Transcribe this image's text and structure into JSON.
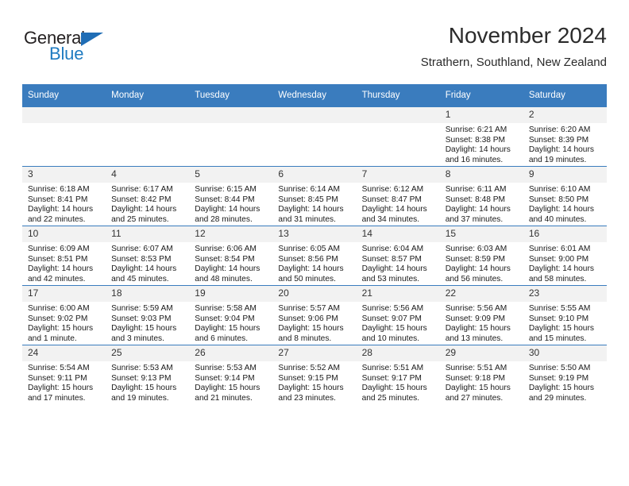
{
  "brand": {
    "name_line1": "General",
    "name_line2": "Blue",
    "triangle_icon": "triangle-icon",
    "colors": {
      "text": "#231f20",
      "blue": "#1f7bc1"
    }
  },
  "header": {
    "title": "November 2024",
    "subtitle": "Strathern, Southland, New Zealand"
  },
  "theme": {
    "header_blue": "#3a7cbe",
    "daynum_band": "#f2f2f2",
    "page_bg": "#ffffff"
  },
  "calendar": {
    "weekday_headers": [
      "Sunday",
      "Monday",
      "Tuesday",
      "Wednesday",
      "Thursday",
      "Friday",
      "Saturday"
    ],
    "weeks": [
      [
        {
          "day": "",
          "empty": true
        },
        {
          "day": "",
          "empty": true
        },
        {
          "day": "",
          "empty": true
        },
        {
          "day": "",
          "empty": true
        },
        {
          "day": "",
          "empty": true
        },
        {
          "day": "1",
          "sunrise": "Sunrise: 6:21 AM",
          "sunset": "Sunset: 8:38 PM",
          "daylight_line1": "Daylight: 14 hours",
          "daylight_line2": "and 16 minutes."
        },
        {
          "day": "2",
          "sunrise": "Sunrise: 6:20 AM",
          "sunset": "Sunset: 8:39 PM",
          "daylight_line1": "Daylight: 14 hours",
          "daylight_line2": "and 19 minutes."
        }
      ],
      [
        {
          "day": "3",
          "sunrise": "Sunrise: 6:18 AM",
          "sunset": "Sunset: 8:41 PM",
          "daylight_line1": "Daylight: 14 hours",
          "daylight_line2": "and 22 minutes."
        },
        {
          "day": "4",
          "sunrise": "Sunrise: 6:17 AM",
          "sunset": "Sunset: 8:42 PM",
          "daylight_line1": "Daylight: 14 hours",
          "daylight_line2": "and 25 minutes."
        },
        {
          "day": "5",
          "sunrise": "Sunrise: 6:15 AM",
          "sunset": "Sunset: 8:44 PM",
          "daylight_line1": "Daylight: 14 hours",
          "daylight_line2": "and 28 minutes."
        },
        {
          "day": "6",
          "sunrise": "Sunrise: 6:14 AM",
          "sunset": "Sunset: 8:45 PM",
          "daylight_line1": "Daylight: 14 hours",
          "daylight_line2": "and 31 minutes."
        },
        {
          "day": "7",
          "sunrise": "Sunrise: 6:12 AM",
          "sunset": "Sunset: 8:47 PM",
          "daylight_line1": "Daylight: 14 hours",
          "daylight_line2": "and 34 minutes."
        },
        {
          "day": "8",
          "sunrise": "Sunrise: 6:11 AM",
          "sunset": "Sunset: 8:48 PM",
          "daylight_line1": "Daylight: 14 hours",
          "daylight_line2": "and 37 minutes."
        },
        {
          "day": "9",
          "sunrise": "Sunrise: 6:10 AM",
          "sunset": "Sunset: 8:50 PM",
          "daylight_line1": "Daylight: 14 hours",
          "daylight_line2": "and 40 minutes."
        }
      ],
      [
        {
          "day": "10",
          "sunrise": "Sunrise: 6:09 AM",
          "sunset": "Sunset: 8:51 PM",
          "daylight_line1": "Daylight: 14 hours",
          "daylight_line2": "and 42 minutes."
        },
        {
          "day": "11",
          "sunrise": "Sunrise: 6:07 AM",
          "sunset": "Sunset: 8:53 PM",
          "daylight_line1": "Daylight: 14 hours",
          "daylight_line2": "and 45 minutes."
        },
        {
          "day": "12",
          "sunrise": "Sunrise: 6:06 AM",
          "sunset": "Sunset: 8:54 PM",
          "daylight_line1": "Daylight: 14 hours",
          "daylight_line2": "and 48 minutes."
        },
        {
          "day": "13",
          "sunrise": "Sunrise: 6:05 AM",
          "sunset": "Sunset: 8:56 PM",
          "daylight_line1": "Daylight: 14 hours",
          "daylight_line2": "and 50 minutes."
        },
        {
          "day": "14",
          "sunrise": "Sunrise: 6:04 AM",
          "sunset": "Sunset: 8:57 PM",
          "daylight_line1": "Daylight: 14 hours",
          "daylight_line2": "and 53 minutes."
        },
        {
          "day": "15",
          "sunrise": "Sunrise: 6:03 AM",
          "sunset": "Sunset: 8:59 PM",
          "daylight_line1": "Daylight: 14 hours",
          "daylight_line2": "and 56 minutes."
        },
        {
          "day": "16",
          "sunrise": "Sunrise: 6:01 AM",
          "sunset": "Sunset: 9:00 PM",
          "daylight_line1": "Daylight: 14 hours",
          "daylight_line2": "and 58 minutes."
        }
      ],
      [
        {
          "day": "17",
          "sunrise": "Sunrise: 6:00 AM",
          "sunset": "Sunset: 9:02 PM",
          "daylight_line1": "Daylight: 15 hours",
          "daylight_line2": "and 1 minute."
        },
        {
          "day": "18",
          "sunrise": "Sunrise: 5:59 AM",
          "sunset": "Sunset: 9:03 PM",
          "daylight_line1": "Daylight: 15 hours",
          "daylight_line2": "and 3 minutes."
        },
        {
          "day": "19",
          "sunrise": "Sunrise: 5:58 AM",
          "sunset": "Sunset: 9:04 PM",
          "daylight_line1": "Daylight: 15 hours",
          "daylight_line2": "and 6 minutes."
        },
        {
          "day": "20",
          "sunrise": "Sunrise: 5:57 AM",
          "sunset": "Sunset: 9:06 PM",
          "daylight_line1": "Daylight: 15 hours",
          "daylight_line2": "and 8 minutes."
        },
        {
          "day": "21",
          "sunrise": "Sunrise: 5:56 AM",
          "sunset": "Sunset: 9:07 PM",
          "daylight_line1": "Daylight: 15 hours",
          "daylight_line2": "and 10 minutes."
        },
        {
          "day": "22",
          "sunrise": "Sunrise: 5:56 AM",
          "sunset": "Sunset: 9:09 PM",
          "daylight_line1": "Daylight: 15 hours",
          "daylight_line2": "and 13 minutes."
        },
        {
          "day": "23",
          "sunrise": "Sunrise: 5:55 AM",
          "sunset": "Sunset: 9:10 PM",
          "daylight_line1": "Daylight: 15 hours",
          "daylight_line2": "and 15 minutes."
        }
      ],
      [
        {
          "day": "24",
          "sunrise": "Sunrise: 5:54 AM",
          "sunset": "Sunset: 9:11 PM",
          "daylight_line1": "Daylight: 15 hours",
          "daylight_line2": "and 17 minutes."
        },
        {
          "day": "25",
          "sunrise": "Sunrise: 5:53 AM",
          "sunset": "Sunset: 9:13 PM",
          "daylight_line1": "Daylight: 15 hours",
          "daylight_line2": "and 19 minutes."
        },
        {
          "day": "26",
          "sunrise": "Sunrise: 5:53 AM",
          "sunset": "Sunset: 9:14 PM",
          "daylight_line1": "Daylight: 15 hours",
          "daylight_line2": "and 21 minutes."
        },
        {
          "day": "27",
          "sunrise": "Sunrise: 5:52 AM",
          "sunset": "Sunset: 9:15 PM",
          "daylight_line1": "Daylight: 15 hours",
          "daylight_line2": "and 23 minutes."
        },
        {
          "day": "28",
          "sunrise": "Sunrise: 5:51 AM",
          "sunset": "Sunset: 9:17 PM",
          "daylight_line1": "Daylight: 15 hours",
          "daylight_line2": "and 25 minutes."
        },
        {
          "day": "29",
          "sunrise": "Sunrise: 5:51 AM",
          "sunset": "Sunset: 9:18 PM",
          "daylight_line1": "Daylight: 15 hours",
          "daylight_line2": "and 27 minutes."
        },
        {
          "day": "30",
          "sunrise": "Sunrise: 5:50 AM",
          "sunset": "Sunset: 9:19 PM",
          "daylight_line1": "Daylight: 15 hours",
          "daylight_line2": "and 29 minutes."
        }
      ]
    ]
  }
}
